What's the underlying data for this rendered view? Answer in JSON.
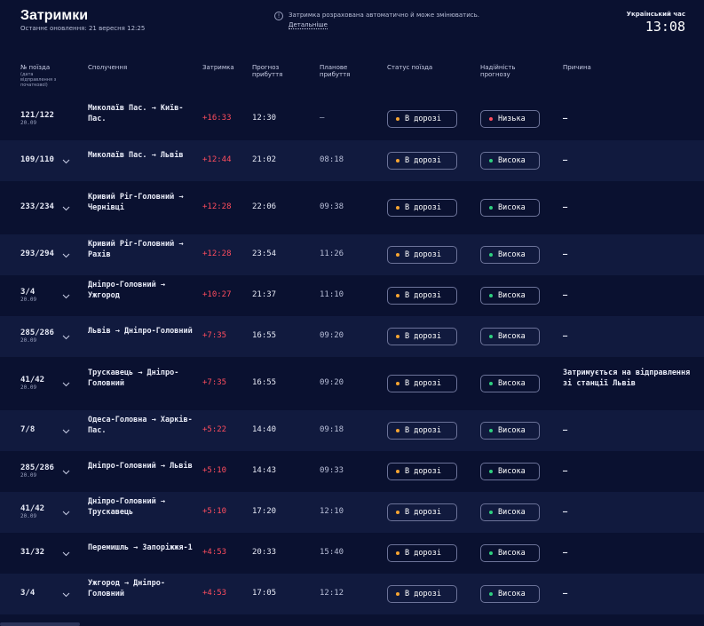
{
  "header": {
    "title": "Затримки",
    "updated": "Останнє оновлення: 21 вересня 12:25",
    "notice_text": "Затримка розрахована автоматично й може змінюватись.",
    "notice_link": "Детальніше",
    "clock_label": "Український час",
    "clock": "13:08"
  },
  "columns": {
    "train": "№ поїзда",
    "train_sub": "(дата відправлення з початкової)",
    "route": "Сполучення",
    "delay": "Затримка",
    "forecast": "Прогноз прибуття",
    "planned": "Планове прибуття",
    "status": "Статус поїзда",
    "reliability": "Надійність прогнозу",
    "reason": "Причина"
  },
  "colors": {
    "delay": "#ff4d5e",
    "status_dot": "#f7a531",
    "high": "#2fd07f",
    "low": "#ff4d5e"
  },
  "rows": [
    {
      "train": "121/122",
      "date": "20.09",
      "route": "Миколаїв Пас. → Київ-Пас.",
      "delay": "+16:33",
      "forecast": "12:30",
      "planned": "—",
      "status": "В дорозі",
      "reliability": "Низька",
      "rel_level": "low",
      "reason": "—",
      "chevron": false
    },
    {
      "train": "109/110",
      "date": "",
      "route": "Миколаїв Пас. → Львів",
      "delay": "+12:44",
      "forecast": "21:02",
      "planned": "08:18",
      "status": "В дорозі",
      "reliability": "Висока",
      "rel_level": "high",
      "reason": "—",
      "chevron": true
    },
    {
      "train": "233/234",
      "date": "",
      "route": "Кривий Ріг-Головний → Чернівці",
      "delay": "+12:28",
      "forecast": "22:06",
      "planned": "09:38",
      "status": "В дорозі",
      "reliability": "Висока",
      "rel_level": "high",
      "reason": "—",
      "chevron": true
    },
    {
      "train": "293/294",
      "date": "",
      "route": "Кривий Ріг-Головний →  Рахів",
      "delay": "+12:28",
      "forecast": "23:54",
      "planned": "11:26",
      "status": "В дорозі",
      "reliability": "Висока",
      "rel_level": "high",
      "reason": "—",
      "chevron": true
    },
    {
      "train": "3/4",
      "date": "20.09",
      "route": "Дніпро-Головний → Ужгород",
      "delay": "+10:27",
      "forecast": "21:37",
      "planned": "11:10",
      "status": "В дорозі",
      "reliability": "Висока",
      "rel_level": "high",
      "reason": "—",
      "chevron": true
    },
    {
      "train": "285/286",
      "date": "20.09",
      "route": "Львів →  Дніпро-Головний",
      "delay": "+7:35",
      "forecast": "16:55",
      "planned": "09:20",
      "status": "В дорозі",
      "reliability": "Висока",
      "rel_level": "high",
      "reason": "—",
      "chevron": true
    },
    {
      "train": "41/42",
      "date": "20.09",
      "route": "Трускавець → Дніпро-Головний",
      "delay": "+7:35",
      "forecast": "16:55",
      "planned": "09:20",
      "status": "В дорозі",
      "reliability": "Висока",
      "rel_level": "high",
      "reason": "Затримується на відправлення зі станції Львів",
      "chevron": true
    },
    {
      "train": "7/8",
      "date": "",
      "route": "Одеса-Головна → Харків-Пас.",
      "delay": "+5:22",
      "forecast": "14:40",
      "planned": "09:18",
      "status": "В дорозі",
      "reliability": "Висока",
      "rel_level": "high",
      "reason": "—",
      "chevron": true
    },
    {
      "train": "285/286",
      "date": "20.09",
      "route": "Дніпро-Головний → Львів",
      "delay": "+5:10",
      "forecast": "14:43",
      "planned": "09:33",
      "status": "В дорозі",
      "reliability": "Висока",
      "rel_level": "high",
      "reason": "—",
      "chevron": true
    },
    {
      "train": "41/42",
      "date": "20.09",
      "route": "Дніпро-Головний → Трускавець",
      "delay": "+5:10",
      "forecast": "17:20",
      "planned": "12:10",
      "status": "В дорозі",
      "reliability": "Висока",
      "rel_level": "high",
      "reason": "—",
      "chevron": true
    },
    {
      "train": "31/32",
      "date": "",
      "route": "Перемишль → Запоріжжя-1",
      "delay": "+4:53",
      "forecast": "20:33",
      "planned": "15:40",
      "status": "В дорозі",
      "reliability": "Висока",
      "rel_level": "high",
      "reason": "—",
      "chevron": true
    },
    {
      "train": "3/4",
      "date": "",
      "route": "Ужгород →  Дніпро-Головний",
      "delay": "+4:53",
      "forecast": "17:05",
      "planned": "12:12",
      "status": "В дорозі",
      "reliability": "Висока",
      "rel_level": "high",
      "reason": "—",
      "chevron": true
    }
  ]
}
